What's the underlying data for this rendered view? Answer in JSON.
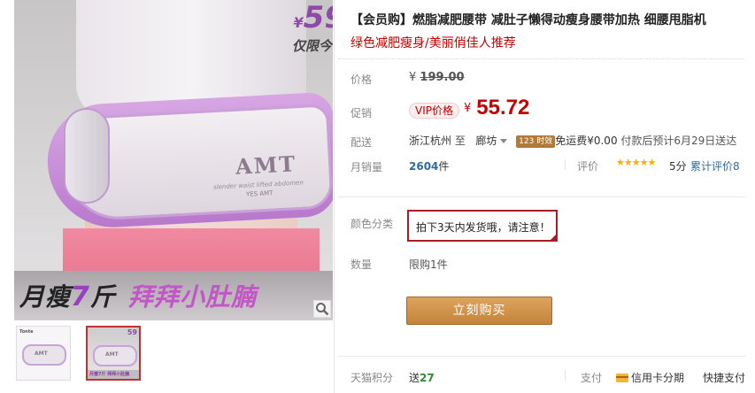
{
  "gallery": {
    "price_badge": {
      "currency": "¥",
      "amount": "59",
      "tag": "仅限今日"
    },
    "product_brand": "AMT",
    "product_subtext": "slender waist lifted abdomen",
    "product_brand_small": "YES AMT",
    "slogan": {
      "left_a": "月瘦",
      "left_num": "7",
      "left_b": "斤",
      "right": "拜拜小肚腩"
    },
    "thumbs": [
      {
        "name": "Tonte",
        "label": "AMT"
      },
      {
        "label": "AMT",
        "price": "59",
        "strip": "月瘦7斤 拜拜小肚腩"
      }
    ]
  },
  "info": {
    "title": "【会员购】燃脂减肥腰带 减肚子懒得动瘦身腰带加热 细腰甩脂机",
    "subtitle": "绿色减肥瘦身/美丽俏佳人推荐",
    "price": {
      "label": "价格",
      "currency": "¥",
      "original": "199.00"
    },
    "promo": {
      "label": "促销",
      "tag": "VIP价格",
      "currency": "¥",
      "value": "55.72"
    },
    "shipping": {
      "label": "配送",
      "from": "浙江杭州",
      "to_word": "至",
      "destination": "廊坊",
      "hours_badge": "123 时效",
      "free": "免运费",
      "fee": "¥0.00",
      "note": "付款后预计6月29日送达"
    },
    "sales": {
      "label": "月销量",
      "count": "2604",
      "unit": "件"
    },
    "rating": {
      "label": "评价",
      "stars": "★★★★★",
      "score": "5分",
      "reviews": "累计评价8"
    },
    "sku": {
      "label": "颜色分类",
      "note": "拍下3天内发货哦，请注意！"
    },
    "quantity": {
      "label": "数量",
      "limit": "限购1件"
    },
    "buy_button": "立刻购买",
    "points": {
      "label": "天猫积分",
      "prefix": "送",
      "value": "27"
    },
    "payment": {
      "label": "支付",
      "credit": "信用卡分期",
      "quick": "快捷支付"
    }
  },
  "colors": {
    "accent_red": "#c40000",
    "buy_button": "#c4843a",
    "link_blue": "#2e6c9c",
    "badge_purple": "#8e4aa8"
  }
}
